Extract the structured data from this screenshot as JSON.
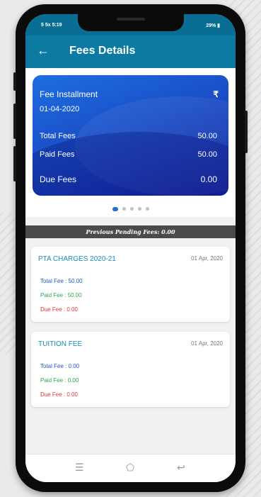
{
  "status_bar": {
    "left": "5 5x 5:19",
    "right": "29% ▮"
  },
  "app_bar": {
    "back_icon": "arrow-left-icon",
    "title": "Fees Details"
  },
  "installment_card": {
    "title": "Fee Installment",
    "currency_symbol": "₹",
    "date": "01-04-2020",
    "total_label": "Total Fees",
    "total_value": "50.00",
    "paid_label": "Paid Fees",
    "paid_value": "50.00",
    "due_label": "Due Fees",
    "due_value": "0.00"
  },
  "carousel": {
    "page_count": 5,
    "active_index": 0
  },
  "previous_pending": "Previous Pending Fees: 0.00",
  "fees": [
    {
      "title": "PTA CHARGES 2020-21",
      "date": "01 Apr, 2020",
      "total": "Total Fee : 50.00",
      "paid": "Paid Fee : 50.00",
      "due": "Due Fee : 0.00"
    },
    {
      "title": "TUITION FEE",
      "date": "01 Apr, 2020",
      "total": "Total Fee : 0.00",
      "paid": "Paid Fee : 0.00",
      "due": "Due Fee : 0.00"
    }
  ],
  "nav": {
    "recent_icon": "menu-icon",
    "home_icon": "home-icon",
    "back_icon": "return-icon"
  },
  "colors": {
    "app_bar": "#0d7aa1",
    "card_start": "#1d6fe0",
    "card_end": "#13209e",
    "total": "#2455d8",
    "paid": "#2fa74f",
    "due": "#e2323a",
    "fee_title": "#1a8ab8"
  }
}
